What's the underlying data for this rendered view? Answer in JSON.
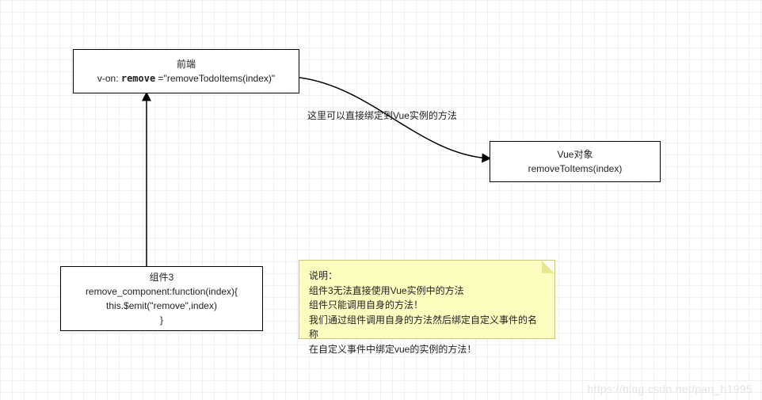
{
  "frontend_box": {
    "title": "前端",
    "code_prefix": "v-on: ",
    "code_kw": "remove",
    "code_suffix": " =\"removeTodoItems(index)\""
  },
  "vue_box": {
    "title": "Vue对象",
    "method": "removeToItems(index)"
  },
  "component_box": {
    "title": "组件3",
    "line1": "remove_component:function(index){",
    "line2": "this.$emit(\"remove\",index)",
    "line3": "}"
  },
  "arrow_label": "这里可以直接绑定到Vue实例的方法",
  "note": {
    "l1": "说明：",
    "l2": "组件3无法直接使用Vue实例中的方法",
    "l3": "组件只能调用自身的方法！",
    "l4": "我们通过组件调用自身的方法然后绑定自定义事件的名称",
    "l5": "在自定义事件中绑定vue的实例的方法！"
  },
  "watermark": "https://blog.csdn.net/pan_h1995"
}
